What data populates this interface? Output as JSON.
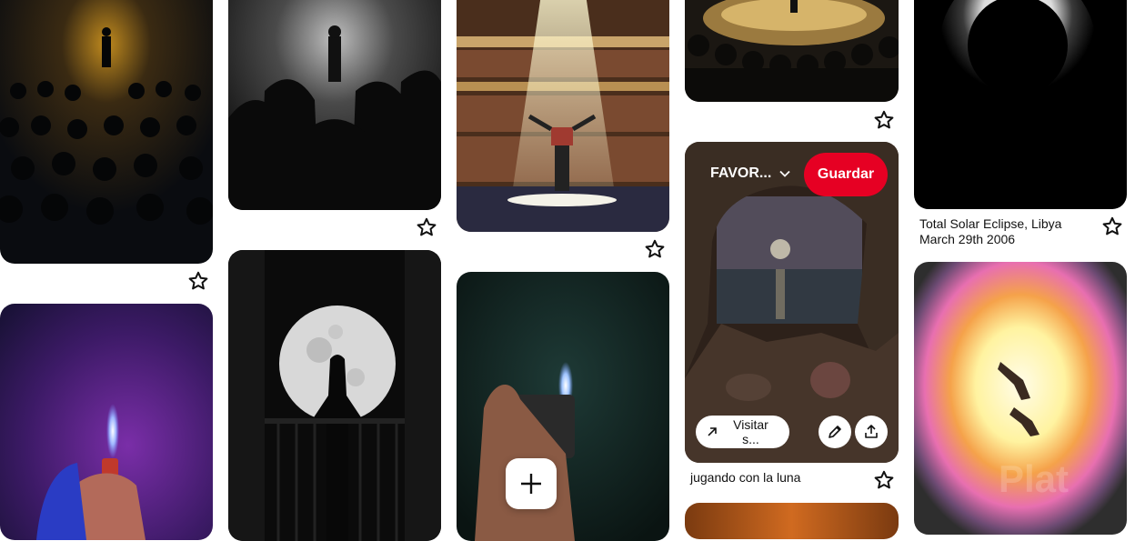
{
  "pins": {
    "eclipse": {
      "title_line1": "Total Solar Eclipse, Libya",
      "title_line2": "March 29th 2006"
    },
    "moon_cave": {
      "title": "jugando con la luna",
      "board_label": "FAVOR...",
      "save_label": "Guardar",
      "visit_label": "Visitar s..."
    }
  },
  "watermark": "Plat",
  "colors": {
    "accent": "#e60023"
  },
  "icons": [
    "star-icon",
    "chevron-down-icon",
    "arrow-up-right-icon",
    "pencil-icon",
    "share-icon",
    "plus-icon"
  ]
}
